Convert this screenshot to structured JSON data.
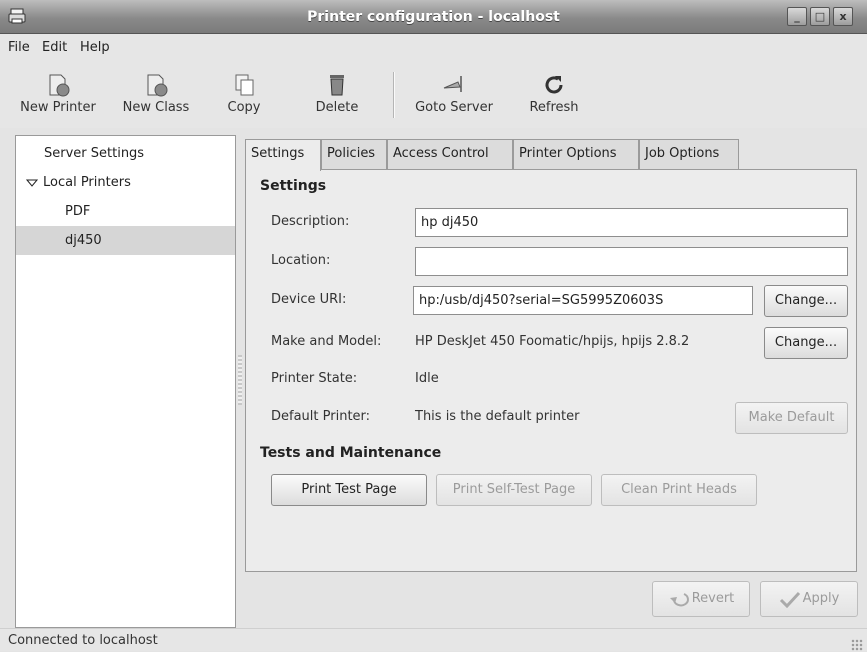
{
  "window": {
    "title": "Printer configuration - localhost",
    "btn_min": "_",
    "btn_max": "□",
    "btn_close": "x"
  },
  "menu": [
    "File",
    "Edit",
    "Help"
  ],
  "toolbar": [
    {
      "label": "New Printer",
      "icon": "new-printer-icon"
    },
    {
      "label": "New Class",
      "icon": "new-class-icon"
    },
    {
      "label": "Copy",
      "icon": "copy-icon"
    },
    {
      "label": "Delete",
      "icon": "delete-icon"
    },
    {
      "label": "Goto Server",
      "icon": "goto-server-icon"
    },
    {
      "label": "Refresh",
      "icon": "refresh-icon"
    }
  ],
  "tree": {
    "server_settings": "Server Settings",
    "local_printers": "Local Printers",
    "printers": [
      "PDF",
      "dj450"
    ],
    "selected": "dj450"
  },
  "tabs": [
    "Settings",
    "Policies",
    "Access Control",
    "Printer Options",
    "Job Options"
  ],
  "active_tab": "Settings",
  "settings": {
    "section_title": "Settings",
    "description_label": "Description:",
    "description_value": "hp dj450",
    "location_label": "Location:",
    "location_value": "",
    "device_uri_label": "Device URI:",
    "device_uri_value": "hp:/usb/dj450?serial=SG5995Z0603S",
    "device_change_label": "Change...",
    "make_model_label": "Make and Model:",
    "make_model_value": "HP DeskJet 450 Foomatic/hpijs, hpijs 2.8.2",
    "model_change_label": "Change...",
    "state_label": "Printer State:",
    "state_value": "Idle",
    "default_label": "Default Printer:",
    "default_value": "This is the default printer",
    "make_default_label": "Make Default"
  },
  "tests": {
    "section_title": "Tests and Maintenance",
    "print_test_page": "Print Test Page",
    "print_self_test_page": "Print Self-Test Page",
    "clean_print_heads": "Clean Print Heads"
  },
  "actions": {
    "revert": "Revert",
    "apply": "Apply"
  },
  "status": "Connected to localhost"
}
